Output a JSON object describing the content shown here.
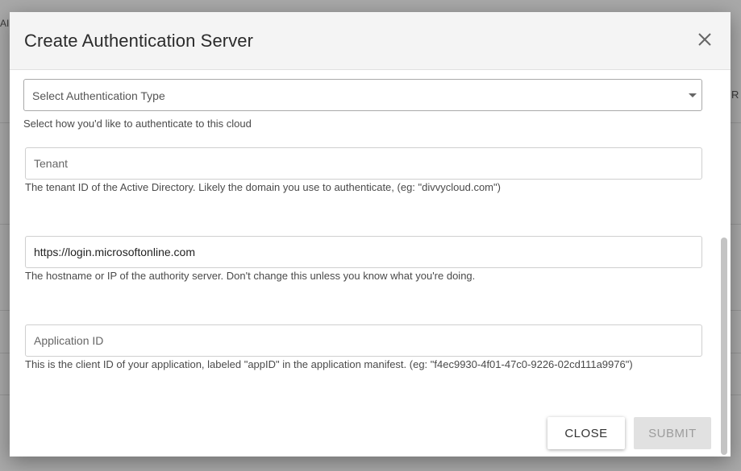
{
  "background": {
    "fragments": [
      "AI",
      "R"
    ]
  },
  "modal": {
    "title": "Create Authentication Server",
    "close_icon": "close-icon",
    "auth_type": {
      "placeholder": "Select Authentication Type",
      "help": "Select how you'd like to authenticate to this cloud"
    },
    "tenant": {
      "value": "",
      "placeholder": "Tenant",
      "help": "The tenant ID of the Active Directory. Likely the domain you use to authenticate, (eg: \"divvycloud.com\")"
    },
    "authority": {
      "value": "https://login.microsoftonline.com",
      "placeholder": "",
      "help": "The hostname or IP of the authority server. Don't change this unless you know what you're doing."
    },
    "application_id": {
      "value": "",
      "placeholder": "Application ID",
      "help": "This is the client ID of your application, labeled \"appID\" in the application manifest. (eg: \"f4ec9930-4f01-47c0-9226-02cd111a9976\")"
    },
    "buttons": {
      "close": "CLOSE",
      "submit": "SUBMIT"
    }
  }
}
